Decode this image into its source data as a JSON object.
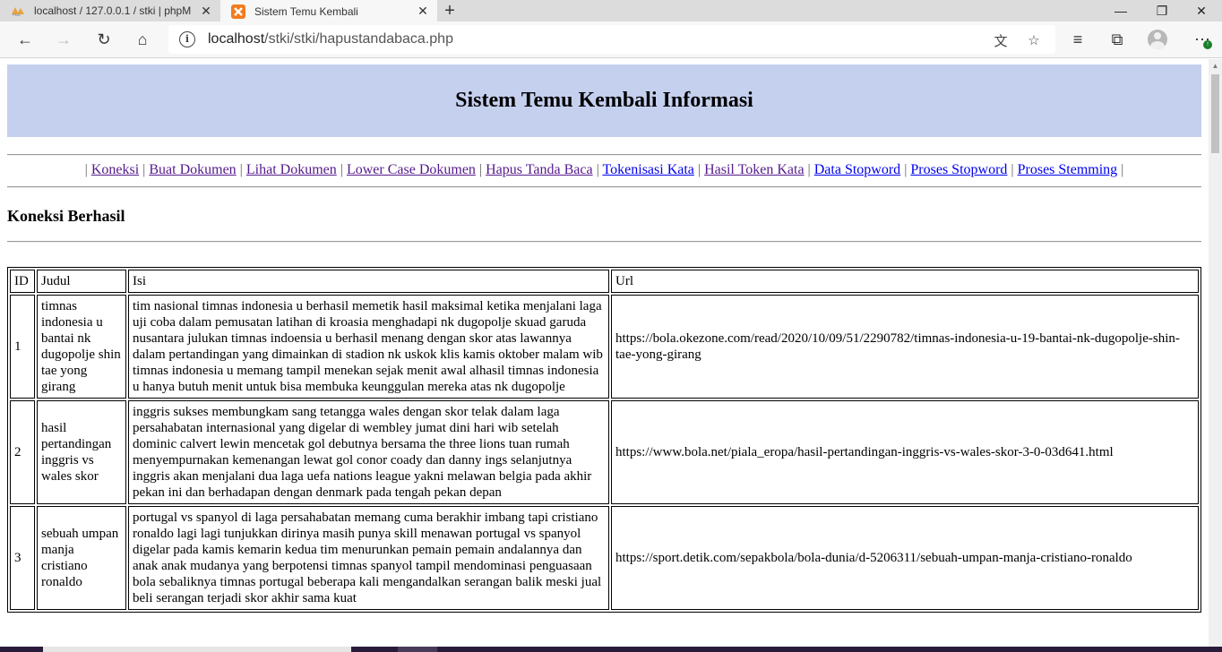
{
  "browser": {
    "tabs": [
      {
        "title": "localhost / 127.0.0.1 / stki | phpM",
        "icon": "phpmyadmin-icon",
        "active": false
      },
      {
        "title": "Sistem Temu Kembali",
        "icon": "xampp-icon",
        "active": true
      }
    ],
    "url_host": "localhost",
    "url_path": "/stki/stki/hapustandabaca.php"
  },
  "page": {
    "title": "Sistem Temu Kembali Informasi",
    "nav": [
      {
        "label": "Koneksi",
        "visited": true
      },
      {
        "label": "Buat Dokumen",
        "visited": true
      },
      {
        "label": "Lihat Dokumen",
        "visited": true
      },
      {
        "label": "Lower Case Dokumen",
        "visited": true
      },
      {
        "label": "Hapus Tanda Baca",
        "visited": true
      },
      {
        "label": "Tokenisasi Kata",
        "visited": false
      },
      {
        "label": "Hasil Token Kata",
        "visited": true
      },
      {
        "label": "Data Stopword",
        "visited": false
      },
      {
        "label": "Proses Stopword",
        "visited": false
      },
      {
        "label": "Proses Stemming",
        "visited": false
      }
    ],
    "status": "Koneksi Berhasil",
    "table": {
      "headers": [
        "ID",
        "Judul",
        "Isi",
        "Url"
      ],
      "rows": [
        {
          "id": "1",
          "judul": "timnas indonesia u bantai nk dugopolje shin tae yong girang",
          "isi": "tim nasional timnas indonesia u berhasil memetik hasil maksimal ketika menjalani laga uji coba dalam pemusatan latihan di kroasia menghadapi nk dugopolje skuad garuda nusantara julukan timnas indoensia u berhasil menang dengan skor atas lawannya dalam pertandingan yang dimainkan di stadion nk uskok klis kamis oktober malam wib timnas indonesia u memang tampil menekan sejak menit awal alhasil timnas indonesia u hanya butuh menit untuk bisa membuka keunggulan mereka atas nk dugopolje",
          "url": "https://bola.okezone.com/read/2020/10/09/51/2290782/timnas-indonesia-u-19-bantai-nk-dugopolje-shin-tae-yong-girang"
        },
        {
          "id": "2",
          "judul": "hasil pertandingan inggris vs wales skor",
          "isi": "inggris sukses membungkam sang tetangga wales dengan skor telak dalam laga persahabatan internasional yang digelar di wembley jumat dini hari wib setelah dominic calvert lewin mencetak gol debutnya bersama the three lions tuan rumah menyempurnakan kemenangan lewat gol conor coady dan danny ings selanjutnya inggris akan menjalani dua laga uefa nations league yakni melawan belgia pada akhir pekan ini dan berhadapan dengan denmark pada tengah pekan depan",
          "url": "https://www.bola.net/piala_eropa/hasil-pertandingan-inggris-vs-wales-skor-3-0-03d641.html"
        },
        {
          "id": "3",
          "judul": "sebuah umpan manja cristiano ronaldo",
          "isi": "portugal vs spanyol di laga persahabatan memang cuma berakhir imbang tapi cristiano ronaldo lagi lagi tunjukkan dirinya masih punya skill menawan portugal vs spanyol digelar pada kamis kemarin kedua tim menurunkan pemain pemain andalannya dan anak anak mudanya yang berpotensi timnas spanyol tampil mendominasi penguasaan bola sebaliknya timnas portugal beberapa kali mengandalkan serangan balik meski jual beli serangan terjadi skor akhir sama kuat",
          "url": "https://sport.detik.com/sepakbola/bola-dunia/d-5206311/sebuah-umpan-manja-cristiano-ronaldo"
        }
      ]
    }
  }
}
